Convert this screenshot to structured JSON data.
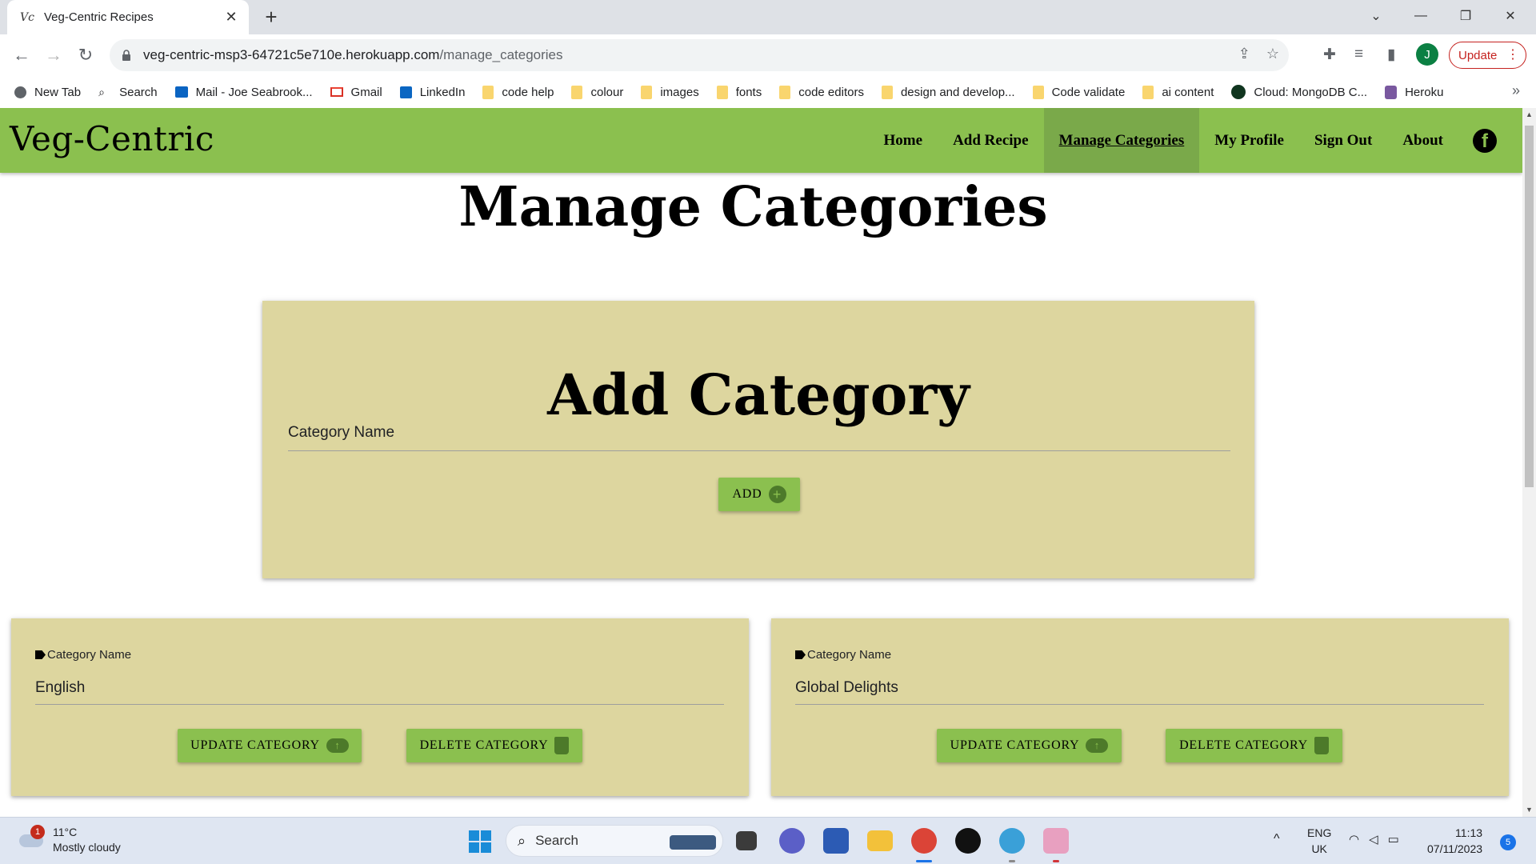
{
  "browser": {
    "tab_title": "Veg-Centric Recipes",
    "tab_favicon": "Vc",
    "url_host": "veg-centric-msp3-64721c5e710e.herokuapp.com",
    "url_path": "/manage_categories",
    "profile_initial": "J",
    "update_label": "Update",
    "bookmarks": [
      {
        "label": "New Tab",
        "icon": "chrome-icon"
      },
      {
        "label": "Search",
        "icon": "search-icon"
      },
      {
        "label": "Mail - Joe Seabrook...",
        "icon": "outlook-icon"
      },
      {
        "label": "Gmail",
        "icon": "gmail-icon"
      },
      {
        "label": "LinkedIn",
        "icon": "linkedin-icon"
      },
      {
        "label": "code help",
        "icon": "folder-icon"
      },
      {
        "label": "colour",
        "icon": "folder-icon"
      },
      {
        "label": "images",
        "icon": "folder-icon"
      },
      {
        "label": "fonts",
        "icon": "folder-icon"
      },
      {
        "label": "code editors",
        "icon": "folder-icon"
      },
      {
        "label": "design and develop...",
        "icon": "folder-icon"
      },
      {
        "label": "Code validate",
        "icon": "folder-icon"
      },
      {
        "label": "ai content",
        "icon": "folder-icon"
      },
      {
        "label": "Cloud: MongoDB C...",
        "icon": "mongodb-icon"
      },
      {
        "label": "Heroku",
        "icon": "heroku-icon"
      }
    ]
  },
  "site": {
    "brand": "Veg-Centric",
    "nav": [
      {
        "label": "Home",
        "active": false
      },
      {
        "label": "Add Recipe",
        "active": false
      },
      {
        "label": "Manage Categories",
        "active": true
      },
      {
        "label": "My Profile",
        "active": false
      },
      {
        "label": "Sign Out",
        "active": false
      },
      {
        "label": "About",
        "active": false
      }
    ],
    "facebook_icon": "f",
    "page_title": "Manage Categories",
    "add_card": {
      "title": "Add Category",
      "field_label": "Category Name",
      "add_button": "ADD",
      "add_icon": "+"
    },
    "categories": [
      {
        "label": "Category Name",
        "value": "English",
        "update_button": "UPDATE CATEGORY",
        "delete_button": "DELETE CATEGORY"
      },
      {
        "label": "Category Name",
        "value": "Global Delights",
        "update_button": "UPDATE CATEGORY",
        "delete_button": "DELETE CATEGORY"
      }
    ],
    "colors": {
      "nav_green": "#8bc04f",
      "card_khaki": "#ddd69f"
    }
  },
  "taskbar": {
    "weather_badge": "1",
    "weather_temp": "11°C",
    "weather_desc": "Mostly cloudy",
    "search_label": "Search",
    "lang_1": "ENG",
    "lang_2": "UK",
    "time": "11:13",
    "date": "07/11/2023",
    "notifications": "5"
  }
}
